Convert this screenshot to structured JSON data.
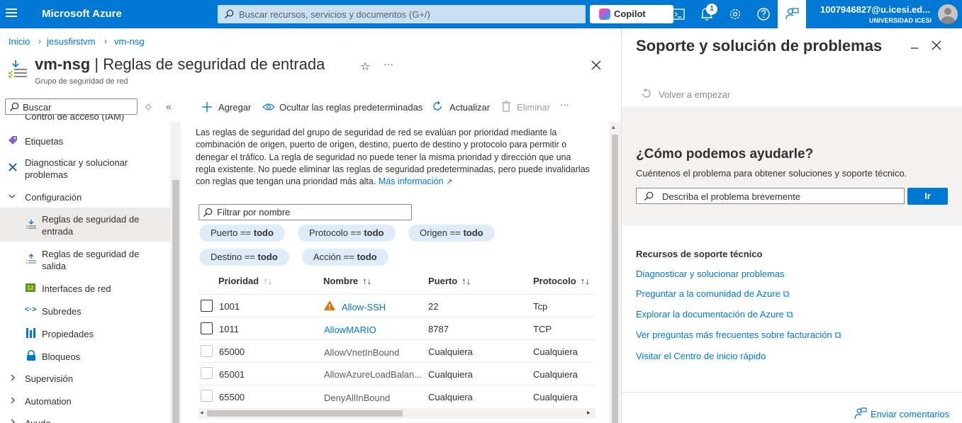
{
  "topbar": {
    "brand": "Microsoft Azure",
    "search_placeholder": "Buscar recursos, servicios y documentos (G+/)",
    "copilot_label": "Copilot",
    "notification_count": "1",
    "account_name": "1007946827@u.icesi.ed...",
    "account_org": "UNIVERSIDAD ICESI",
    "brand_color": "#0078d4"
  },
  "breadcrumb": {
    "items": [
      "Inicio",
      "jesusfirstvm",
      "vm-nsg"
    ]
  },
  "page": {
    "title_resource": "vm-nsg",
    "title_separator": " | ",
    "title_section": "Reglas de seguridad de entrada",
    "subtitle": "Grupo de seguridad de red"
  },
  "sidebar": {
    "search_placeholder": "Buscar",
    "items": [
      {
        "label": "Control de acceso (IAM)"
      },
      {
        "label": "Etiquetas"
      },
      {
        "label": "Diagnosticar y solucionar problemas"
      },
      {
        "label": "Configuración"
      },
      {
        "label": "Reglas de seguridad de entrada"
      },
      {
        "label": "Reglas de seguridad de salida"
      },
      {
        "label": "Interfaces de red"
      },
      {
        "label": "Subredes"
      },
      {
        "label": "Propiedades"
      },
      {
        "label": "Bloqueos"
      },
      {
        "label": "Supervisión"
      },
      {
        "label": "Automation"
      },
      {
        "label": "Ayuda"
      }
    ]
  },
  "toolbar": {
    "add": "Agregar",
    "hide_defaults": "Ocultar las reglas predeterminadas",
    "refresh": "Actualizar",
    "delete": "Eliminar",
    "more": "···"
  },
  "description": {
    "text": "Las reglas de seguridad del grupo de seguridad de red se evalúan por prioridad mediante la combinación de origen, puerto de origen, destino, puerto de destino y protocolo para permitir o denegar el tráfico. La regla de seguridad no puede tener la misma prioridad y dirección que una regla existente. No puede eliminar las reglas de seguridad predeterminadas, pero puede invalidarlas con reglas que tengan una prioridad más alta.",
    "link": "Más información"
  },
  "filter": {
    "placeholder": "Filtrar por nombre",
    "pills": [
      {
        "key": "Puerto",
        "op": " == ",
        "value": "todo"
      },
      {
        "key": "Protocolo",
        "op": " == ",
        "value": "todo"
      },
      {
        "key": "Origen",
        "op": " == ",
        "value": "todo"
      },
      {
        "key": "Destino",
        "op": " == ",
        "value": "todo"
      },
      {
        "key": "Acción",
        "op": " == ",
        "value": "todo"
      }
    ]
  },
  "table": {
    "columns": [
      "Prioridad",
      "Nombre",
      "Puerto",
      "Protocolo"
    ],
    "sort_glyph": "↑↓",
    "rows": [
      {
        "priority": "1001",
        "name": "Allow-SSH",
        "port": "22",
        "protocol": "Tcp",
        "warning": true,
        "custom": true
      },
      {
        "priority": "1011",
        "name": "AllowMARIO",
        "port": "8787",
        "protocol": "TCP",
        "warning": false,
        "custom": true
      },
      {
        "priority": "65000",
        "name": "AllowVnetInBound",
        "port": "Cualquiera",
        "protocol": "Cualquiera",
        "warning": false,
        "custom": false
      },
      {
        "priority": "65001",
        "name": "AllowAzureLoadBalan...",
        "port": "Cualquiera",
        "protocol": "Cualquiera",
        "warning": false,
        "custom": false
      },
      {
        "priority": "65500",
        "name": "DenyAllInBound",
        "port": "Cualquiera",
        "protocol": "Cualquiera",
        "warning": false,
        "custom": false
      }
    ]
  },
  "panel": {
    "title": "Soporte y solución de problemas",
    "restart": "Volver a empezar",
    "help_heading": "¿Cómo podemos ayudarle?",
    "help_sub": "Cuéntenos el problema para obtener soluciones y soporte técnico.",
    "help_placeholder": "Describa el problema brevemente",
    "go_label": "Ir",
    "resources_heading": "Recursos de soporte técnico",
    "links": [
      "Diagnosticar y solucionar problemas",
      "Preguntar a la comunidad de Azure",
      "Explorar la documentación de Azure",
      "Ver preguntas más frecuentes sobre facturación",
      "Visitar el Centro de inicio rápido"
    ],
    "feedback": "Enviar comentarios"
  }
}
